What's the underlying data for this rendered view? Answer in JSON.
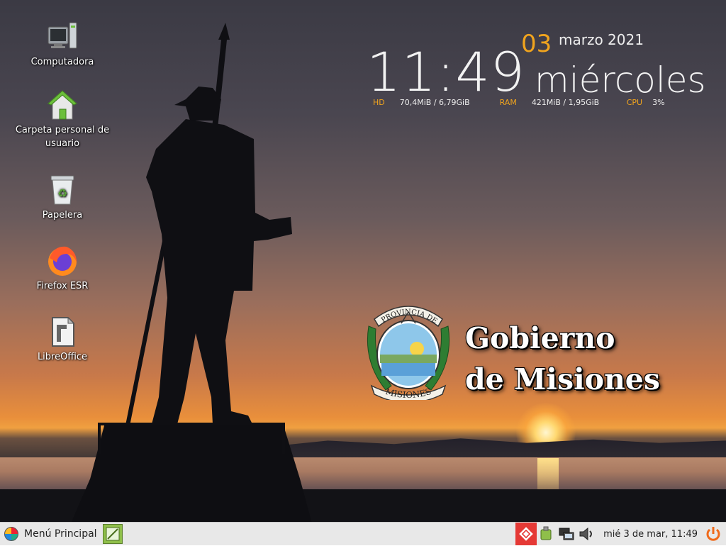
{
  "desktop": {
    "icons": [
      {
        "label": "Computadora",
        "icon": "computer-icon"
      },
      {
        "label": "Carpeta personal de usuario",
        "icon": "home-folder-icon"
      },
      {
        "label": "Papelera",
        "icon": "trash-icon"
      },
      {
        "label": "Firefox ESR",
        "icon": "firefox-icon"
      },
      {
        "label": "LibreOffice",
        "icon": "libreoffice-icon"
      }
    ]
  },
  "conky": {
    "time": "11:49",
    "day": "03",
    "month_year": "marzo 2021",
    "weekday": "miércoles",
    "hd_label": "HD",
    "hd_value": "70,4MiB / 6,79GiB",
    "ram_label": "RAM",
    "ram_value": "421MiB / 1,95GiB",
    "cpu_label": "CPU",
    "cpu_value": "3%"
  },
  "wallpaper": {
    "emblem_top_text": "PROVINCIA DE",
    "emblem_bottom_text": "MISIONES",
    "title_line1": "Gobierno",
    "title_line2": "de Misiones"
  },
  "taskbar": {
    "menu_label": "Menú Principal",
    "clock": "mié  3 de mar, 11:49",
    "tray_icons": [
      "anydesk-icon",
      "usb-icon",
      "network-icon",
      "volume-icon",
      "power-icon"
    ]
  },
  "colors": {
    "accent": "#f0a41e",
    "taskbar_bg": "#e8e8e8"
  }
}
